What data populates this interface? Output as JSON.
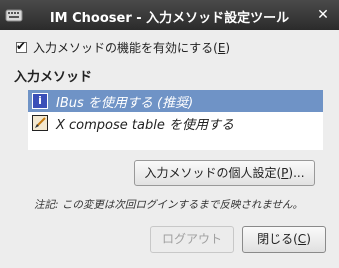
{
  "window": {
    "title": "IM Chooser - 入力メソッド設定ツール",
    "close_glyph": "✕"
  },
  "enable": {
    "label_main": "入力メソッドの機能を有効にする(",
    "mnemonic": "E",
    "label_end": ")",
    "checked": true
  },
  "section": {
    "title": "入力メソッド"
  },
  "im_list": {
    "items": [
      {
        "label": "IBus を使用する (推奨)",
        "icon": "ibus-icon",
        "icon_glyph": "i",
        "selected": true
      },
      {
        "label": "X compose table を使用する",
        "icon": "brush-icon",
        "selected": false
      }
    ]
  },
  "personal": {
    "label_main": "入力メソッドの個人設定(",
    "mnemonic": "P",
    "label_end": ")..."
  },
  "note": "注記: この変更は次回ログインするまで反映されません。",
  "buttons": {
    "logout": "ログアウト",
    "close_main": "閉じる(",
    "close_mnemonic": "C",
    "close_end": ")"
  },
  "colors": {
    "selection": "#6f93c6",
    "titlebar": "#2b2b2b"
  }
}
